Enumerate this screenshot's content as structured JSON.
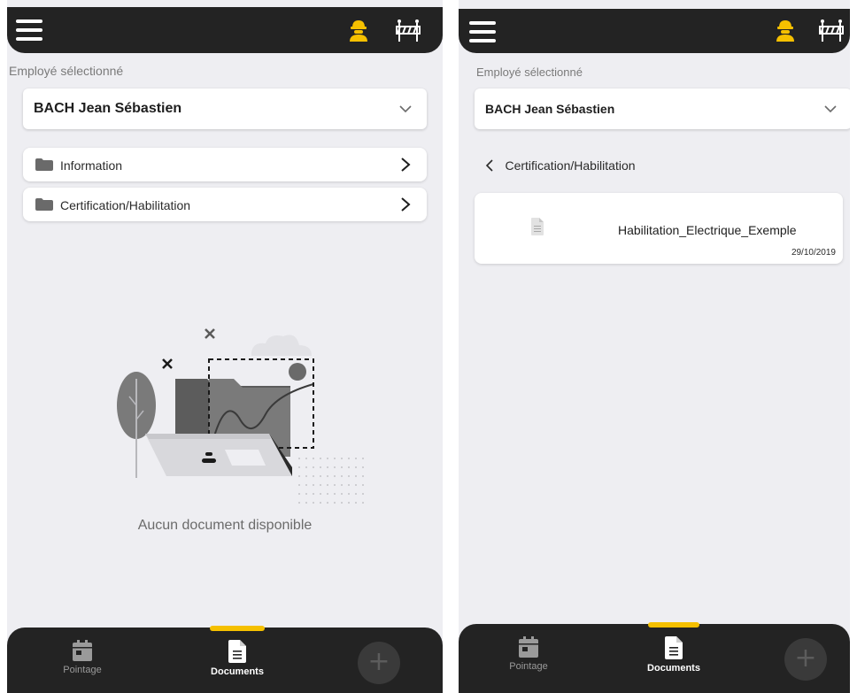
{
  "colors": {
    "accent": "#f5c000",
    "bar": "#232323",
    "background": "#eeeef2"
  },
  "left": {
    "header": {
      "menu_icon": "hamburger-menu-icon",
      "worker_icon": "worker-helmet-icon",
      "barrier_icon": "road-barrier-icon"
    },
    "employee_label": "Employé sélectionné",
    "employee_select": {
      "value": "BACH Jean Sébastien",
      "icon": "chevron-down-icon"
    },
    "folders": [
      {
        "label": "Information",
        "icon": "folder-icon"
      },
      {
        "label": "Certification/Habilitation",
        "icon": "folder-icon"
      }
    ],
    "empty_state": {
      "message": "Aucun document disponible"
    },
    "bottom_nav": {
      "items": [
        {
          "label": "Pointage",
          "icon": "calendar-icon",
          "active": false
        },
        {
          "label": "Documents",
          "icon": "document-icon",
          "active": true
        }
      ],
      "fab": {
        "label": "+",
        "icon": "plus-icon"
      }
    }
  },
  "right": {
    "header": {
      "menu_icon": "hamburger-menu-icon",
      "worker_icon": "worker-helmet-icon",
      "barrier_icon": "road-barrier-icon"
    },
    "employee_label": "Employé sélectionné",
    "employee_select": {
      "value": "BACH Jean Sébastien",
      "icon": "chevron-down-icon"
    },
    "breadcrumb": {
      "label": "Certification/Habilitation",
      "icon": "chevron-left-icon"
    },
    "documents": [
      {
        "name": "Habilitation_Electrique_Exemple",
        "date": "29/10/2019",
        "icon": "file-icon"
      }
    ],
    "bottom_nav": {
      "items": [
        {
          "label": "Pointage",
          "icon": "calendar-icon",
          "active": false
        },
        {
          "label": "Documents",
          "icon": "document-icon",
          "active": true
        }
      ],
      "fab": {
        "label": "+",
        "icon": "plus-icon"
      }
    }
  }
}
